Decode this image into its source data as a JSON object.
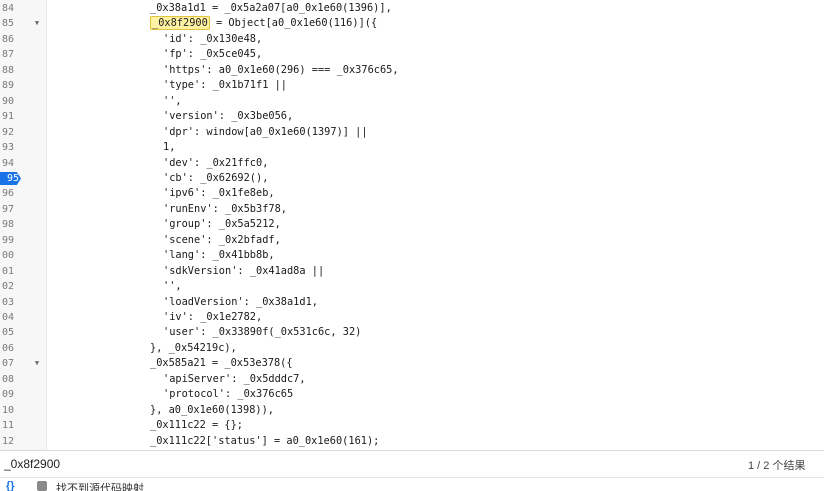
{
  "editor": {
    "lines": [
      {
        "num": "84",
        "fold": false,
        "text": "_0x38a1d1 = _0x5a2a07[a0_0x1e60(1396)],",
        "indent": 0
      },
      {
        "num": "85",
        "fold": true,
        "hl": "_0x8f2900",
        "text": " = Object[a0_0x1e60(116)]({",
        "indent": 0
      },
      {
        "num": "86",
        "fold": false,
        "text": "'id': _0x130e48,",
        "indent": 1
      },
      {
        "num": "87",
        "fold": false,
        "text": "'fp': _0x5ce045,",
        "indent": 1
      },
      {
        "num": "88",
        "fold": false,
        "text": "'https': a0_0x1e60(296) === _0x376c65,",
        "indent": 1
      },
      {
        "num": "89",
        "fold": false,
        "text": "'type': _0x1b71f1 ||",
        "indent": 1
      },
      {
        "num": "90",
        "fold": false,
        "text": "'',",
        "indent": 1
      },
      {
        "num": "91",
        "fold": false,
        "text": "'version': _0x3be056,",
        "indent": 1
      },
      {
        "num": "92",
        "fold": false,
        "text": "'dpr': window[a0_0x1e60(1397)] ||",
        "indent": 1
      },
      {
        "num": "93",
        "fold": false,
        "text": "1,",
        "indent": 1
      },
      {
        "num": "94",
        "fold": false,
        "text": "'dev': _0x21ffc0,",
        "indent": 1
      },
      {
        "num": "95",
        "fold": false,
        "bp": true,
        "text": "'cb': _0x62692(),",
        "indent": 1
      },
      {
        "num": "96",
        "fold": false,
        "text": "'ipv6': _0x1fe8eb,",
        "indent": 1
      },
      {
        "num": "97",
        "fold": false,
        "text": "'runEnv': _0x5b3f78,",
        "indent": 1
      },
      {
        "num": "98",
        "fold": false,
        "text": "'group': _0x5a5212,",
        "indent": 1
      },
      {
        "num": "99",
        "fold": false,
        "text": "'scene': _0x2bfadf,",
        "indent": 1
      },
      {
        "num": "00",
        "fold": false,
        "text": "'lang': _0x41bb8b,",
        "indent": 1
      },
      {
        "num": "01",
        "fold": false,
        "text": "'sdkVersion': _0x41ad8a ||",
        "indent": 1
      },
      {
        "num": "02",
        "fold": false,
        "text": "'',",
        "indent": 1
      },
      {
        "num": "03",
        "fold": false,
        "text": "'loadVersion': _0x38a1d1,",
        "indent": 1
      },
      {
        "num": "04",
        "fold": false,
        "text": "'iv': _0x1e2782,",
        "indent": 1
      },
      {
        "num": "05",
        "fold": false,
        "text": "'user': _0x33890f(_0x531c6c, 32)",
        "indent": 1
      },
      {
        "num": "06",
        "fold": false,
        "text": "}, _0x54219c),",
        "indent": 0
      },
      {
        "num": "07",
        "fold": true,
        "text": "_0x585a21 = _0x53e378({",
        "indent": 0
      },
      {
        "num": "08",
        "fold": false,
        "text": "'apiServer': _0x5dddc7,",
        "indent": 1
      },
      {
        "num": "09",
        "fold": false,
        "text": "'protocol': _0x376c65",
        "indent": 1
      },
      {
        "num": "10",
        "fold": false,
        "text": "}, a0_0x1e60(1398)),",
        "indent": 0
      },
      {
        "num": "11",
        "fold": false,
        "text": "_0x111c22 = {};",
        "indent": 0
      },
      {
        "num": "12",
        "fold": false,
        "text": "_0x111c22['status'] = a0_0x1e60(161);",
        "indent": 0
      }
    ]
  },
  "search": {
    "value": "_0x8f2900",
    "count": "1 / 2 个结果"
  },
  "status": {
    "brace_icon": "{}",
    "box_icon": "package-icon",
    "text": "找不到源代码映射"
  }
}
